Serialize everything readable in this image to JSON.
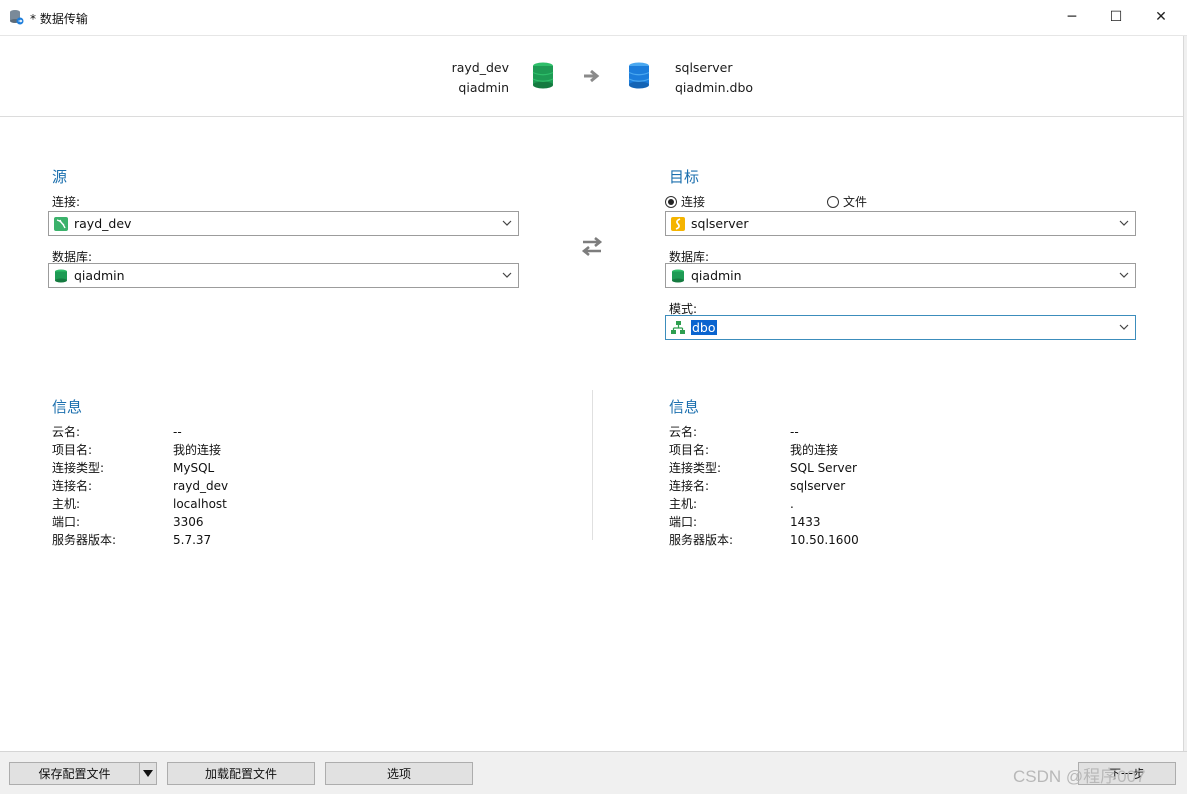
{
  "window": {
    "title": "* 数据传输",
    "minimize_label": "─",
    "maximize_label": "☐",
    "close_label": "✕"
  },
  "header": {
    "source_connection": "rayd_dev",
    "source_database": "qiadmin",
    "target_connection": "sqlserver",
    "target_database": "qiadmin.dbo",
    "source_color": "#1e9b54",
    "target_color": "#1c7ddb"
  },
  "source": {
    "title": "源",
    "connection_label": "连接:",
    "connection_value": "rayd_dev",
    "connection_icon": "mysql-icon",
    "database_label": "数据库:",
    "database_value": "qiadmin",
    "database_icon": "database-icon"
  },
  "target": {
    "title": "目标",
    "radio_connection": "连接",
    "radio_file": "文件",
    "radio_selected": "连接",
    "connection_value": "sqlserver",
    "connection_icon": "sqlserver-icon",
    "database_label": "数据库:",
    "database_value": "qiadmin",
    "schema_label": "模式:",
    "schema_value": "dbo",
    "schema_icon": "schema-icon"
  },
  "source_info": {
    "title": "信息",
    "rows": [
      {
        "k": "云名:",
        "v": "--"
      },
      {
        "k": "项目名:",
        "v": "我的连接"
      },
      {
        "k": "连接类型:",
        "v": "MySQL"
      },
      {
        "k": "连接名:",
        "v": "rayd_dev"
      },
      {
        "k": "主机:",
        "v": "localhost"
      },
      {
        "k": "端口:",
        "v": "3306"
      },
      {
        "k": "服务器版本:",
        "v": "5.7.37"
      }
    ]
  },
  "target_info": {
    "title": "信息",
    "rows": [
      {
        "k": "云名:",
        "v": "--"
      },
      {
        "k": "项目名:",
        "v": "我的连接"
      },
      {
        "k": "连接类型:",
        "v": "SQL Server"
      },
      {
        "k": "连接名:",
        "v": "sqlserver"
      },
      {
        "k": "主机:",
        "v": "."
      },
      {
        "k": "端口:",
        "v": "1433"
      },
      {
        "k": "服务器版本:",
        "v": "10.50.1600"
      }
    ]
  },
  "footer": {
    "save_profile": "保存配置文件",
    "load_profile": "加载配置文件",
    "options": "选项",
    "next": "下一步",
    "watermark": "CSDN @程序007"
  },
  "colors": {
    "accent": "#1b6fae",
    "selection": "#0a64cf"
  }
}
